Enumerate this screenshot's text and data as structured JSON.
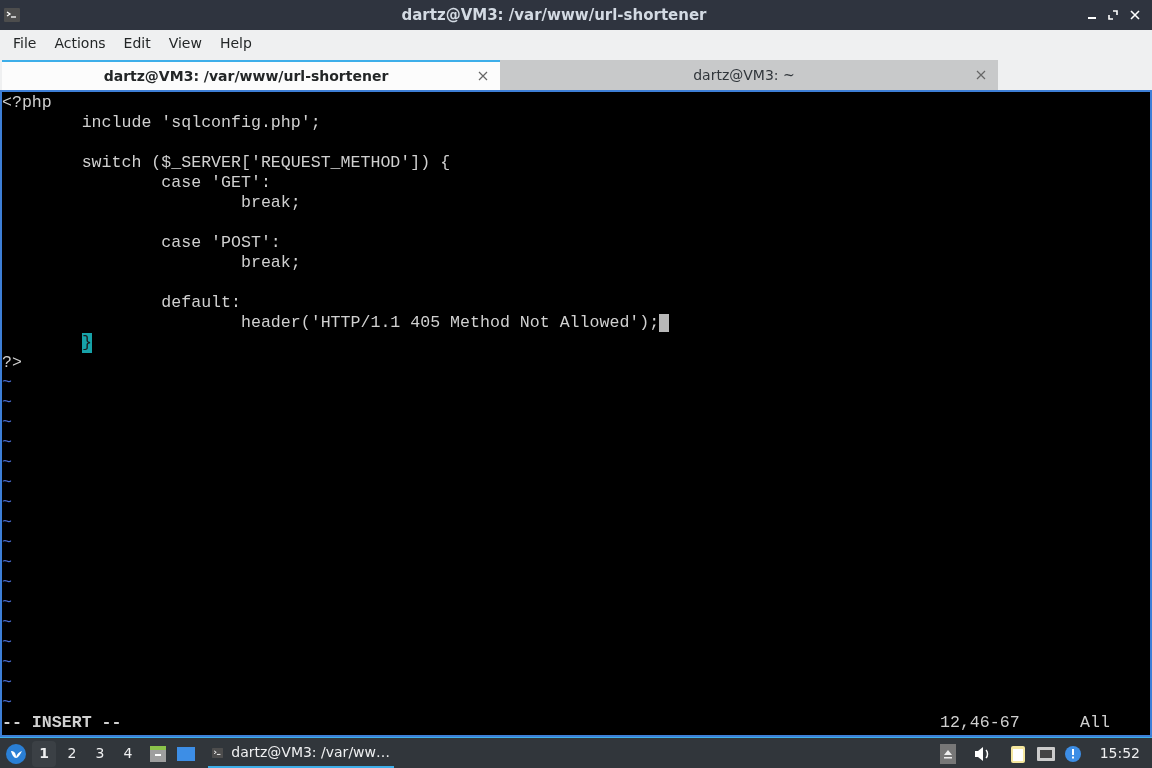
{
  "window": {
    "title": "dartz@VM3: /var/www/url-shortener"
  },
  "menu": [
    "File",
    "Actions",
    "Edit",
    "View",
    "Help"
  ],
  "tabs": [
    {
      "label": "dartz@VM3: /var/www/url-shortener",
      "selected": true
    },
    {
      "label": "dartz@VM3: ~",
      "selected": false
    }
  ],
  "editor": {
    "lines": [
      {
        "kind": "code",
        "text": "<?php"
      },
      {
        "kind": "code",
        "text": "        include 'sqlconfig.php';"
      },
      {
        "kind": "blank"
      },
      {
        "kind": "code",
        "text": "        switch ($_SERVER['REQUEST_METHOD']) {"
      },
      {
        "kind": "code",
        "text": "                case 'GET':"
      },
      {
        "kind": "code",
        "text": "                        break;"
      },
      {
        "kind": "blank"
      },
      {
        "kind": "code",
        "text": "                case 'POST':"
      },
      {
        "kind": "code",
        "text": "                        break;"
      },
      {
        "kind": "blank"
      },
      {
        "kind": "code",
        "text": "                default:"
      },
      {
        "kind": "code",
        "text": "                        header('HTTP/1.1 405 Method Not Allowed');",
        "cursor": true
      },
      {
        "kind": "match",
        "match": "}"
      },
      {
        "kind": "code",
        "text": "?>"
      },
      {
        "kind": "filler",
        "text": "~"
      },
      {
        "kind": "filler",
        "text": "~"
      },
      {
        "kind": "filler",
        "text": "~"
      },
      {
        "kind": "filler",
        "text": "~"
      },
      {
        "kind": "filler",
        "text": "~"
      },
      {
        "kind": "filler",
        "text": "~"
      },
      {
        "kind": "filler",
        "text": "~"
      },
      {
        "kind": "filler",
        "text": "~"
      },
      {
        "kind": "filler",
        "text": "~"
      },
      {
        "kind": "filler",
        "text": "~"
      },
      {
        "kind": "filler",
        "text": "~"
      },
      {
        "kind": "filler",
        "text": "~"
      },
      {
        "kind": "filler",
        "text": "~"
      },
      {
        "kind": "filler",
        "text": "~"
      },
      {
        "kind": "filler",
        "text": "~"
      },
      {
        "kind": "filler",
        "text": "~"
      },
      {
        "kind": "filler",
        "text": "~"
      }
    ],
    "mode": "-- INSERT --",
    "position": "12,46-67",
    "scroll": "All"
  },
  "taskbar": {
    "workspaces": [
      {
        "label": "1",
        "selected": true
      },
      {
        "label": "2",
        "selected": false
      },
      {
        "label": "3",
        "selected": false
      },
      {
        "label": "4",
        "selected": false
      }
    ],
    "task": "dartz@VM3: /var/ww…",
    "clock": "15:52"
  }
}
